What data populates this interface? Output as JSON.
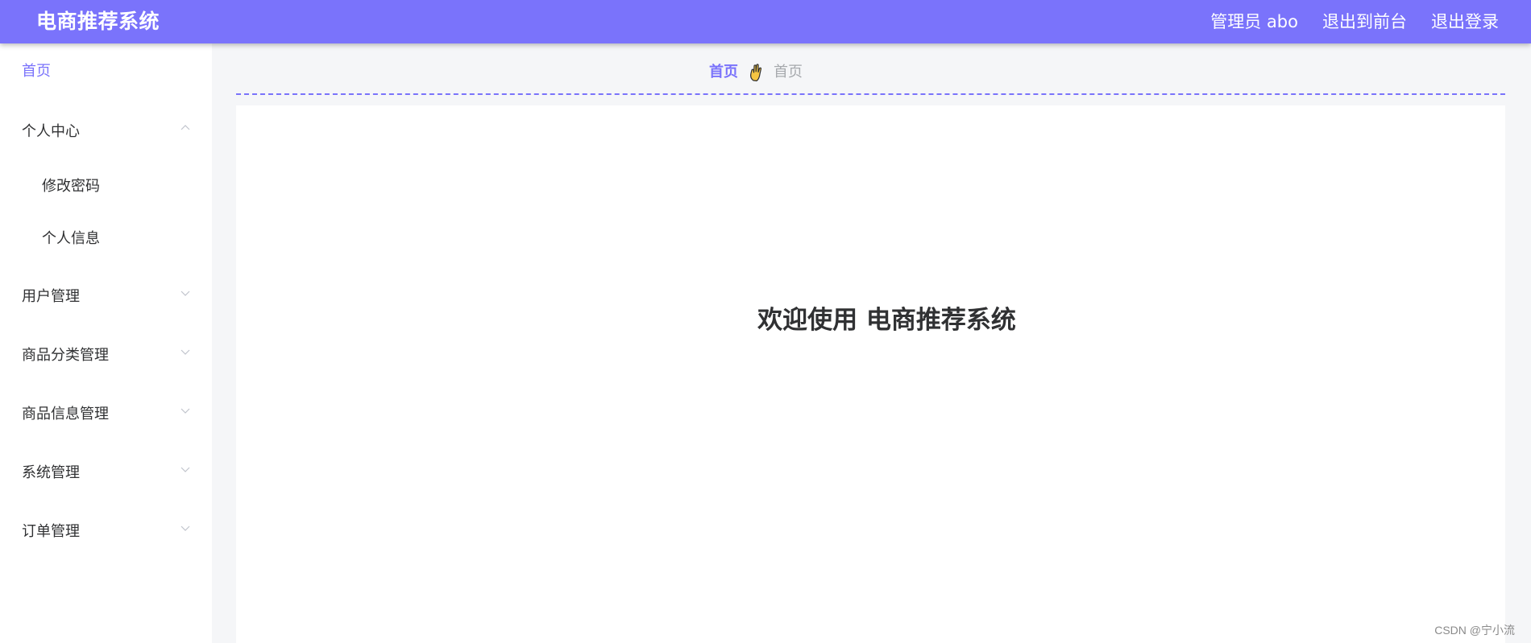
{
  "header": {
    "app_title": "电商推荐系统",
    "user_label": "管理员 abo",
    "front_link": "退出到前台",
    "logout_link": "退出登录"
  },
  "sidebar": {
    "items": [
      {
        "label": "首页",
        "active": true,
        "expandable": false
      },
      {
        "label": "个人中心",
        "active": false,
        "expandable": true,
        "expanded": true
      },
      {
        "label": "修改密码",
        "active": false,
        "sub": true
      },
      {
        "label": "个人信息",
        "active": false,
        "sub": true
      },
      {
        "label": "用户管理",
        "active": false,
        "expandable": true,
        "expanded": false
      },
      {
        "label": "商品分类管理",
        "active": false,
        "expandable": true,
        "expanded": false
      },
      {
        "label": "商品信息管理",
        "active": false,
        "expandable": true,
        "expanded": false
      },
      {
        "label": "系统管理",
        "active": false,
        "expandable": true,
        "expanded": false
      },
      {
        "label": "订单管理",
        "active": false,
        "expandable": true,
        "expanded": false
      }
    ]
  },
  "breadcrumb": {
    "home": "首页",
    "separator_icon": "hand-icon",
    "current": "首页"
  },
  "main": {
    "welcome": "欢迎使用 电商推荐系统"
  },
  "watermark": "CSDN @宁小流",
  "colors": {
    "accent": "#7a73fb",
    "header_bg": "#7a73fb",
    "page_bg": "#f5f6f8"
  }
}
